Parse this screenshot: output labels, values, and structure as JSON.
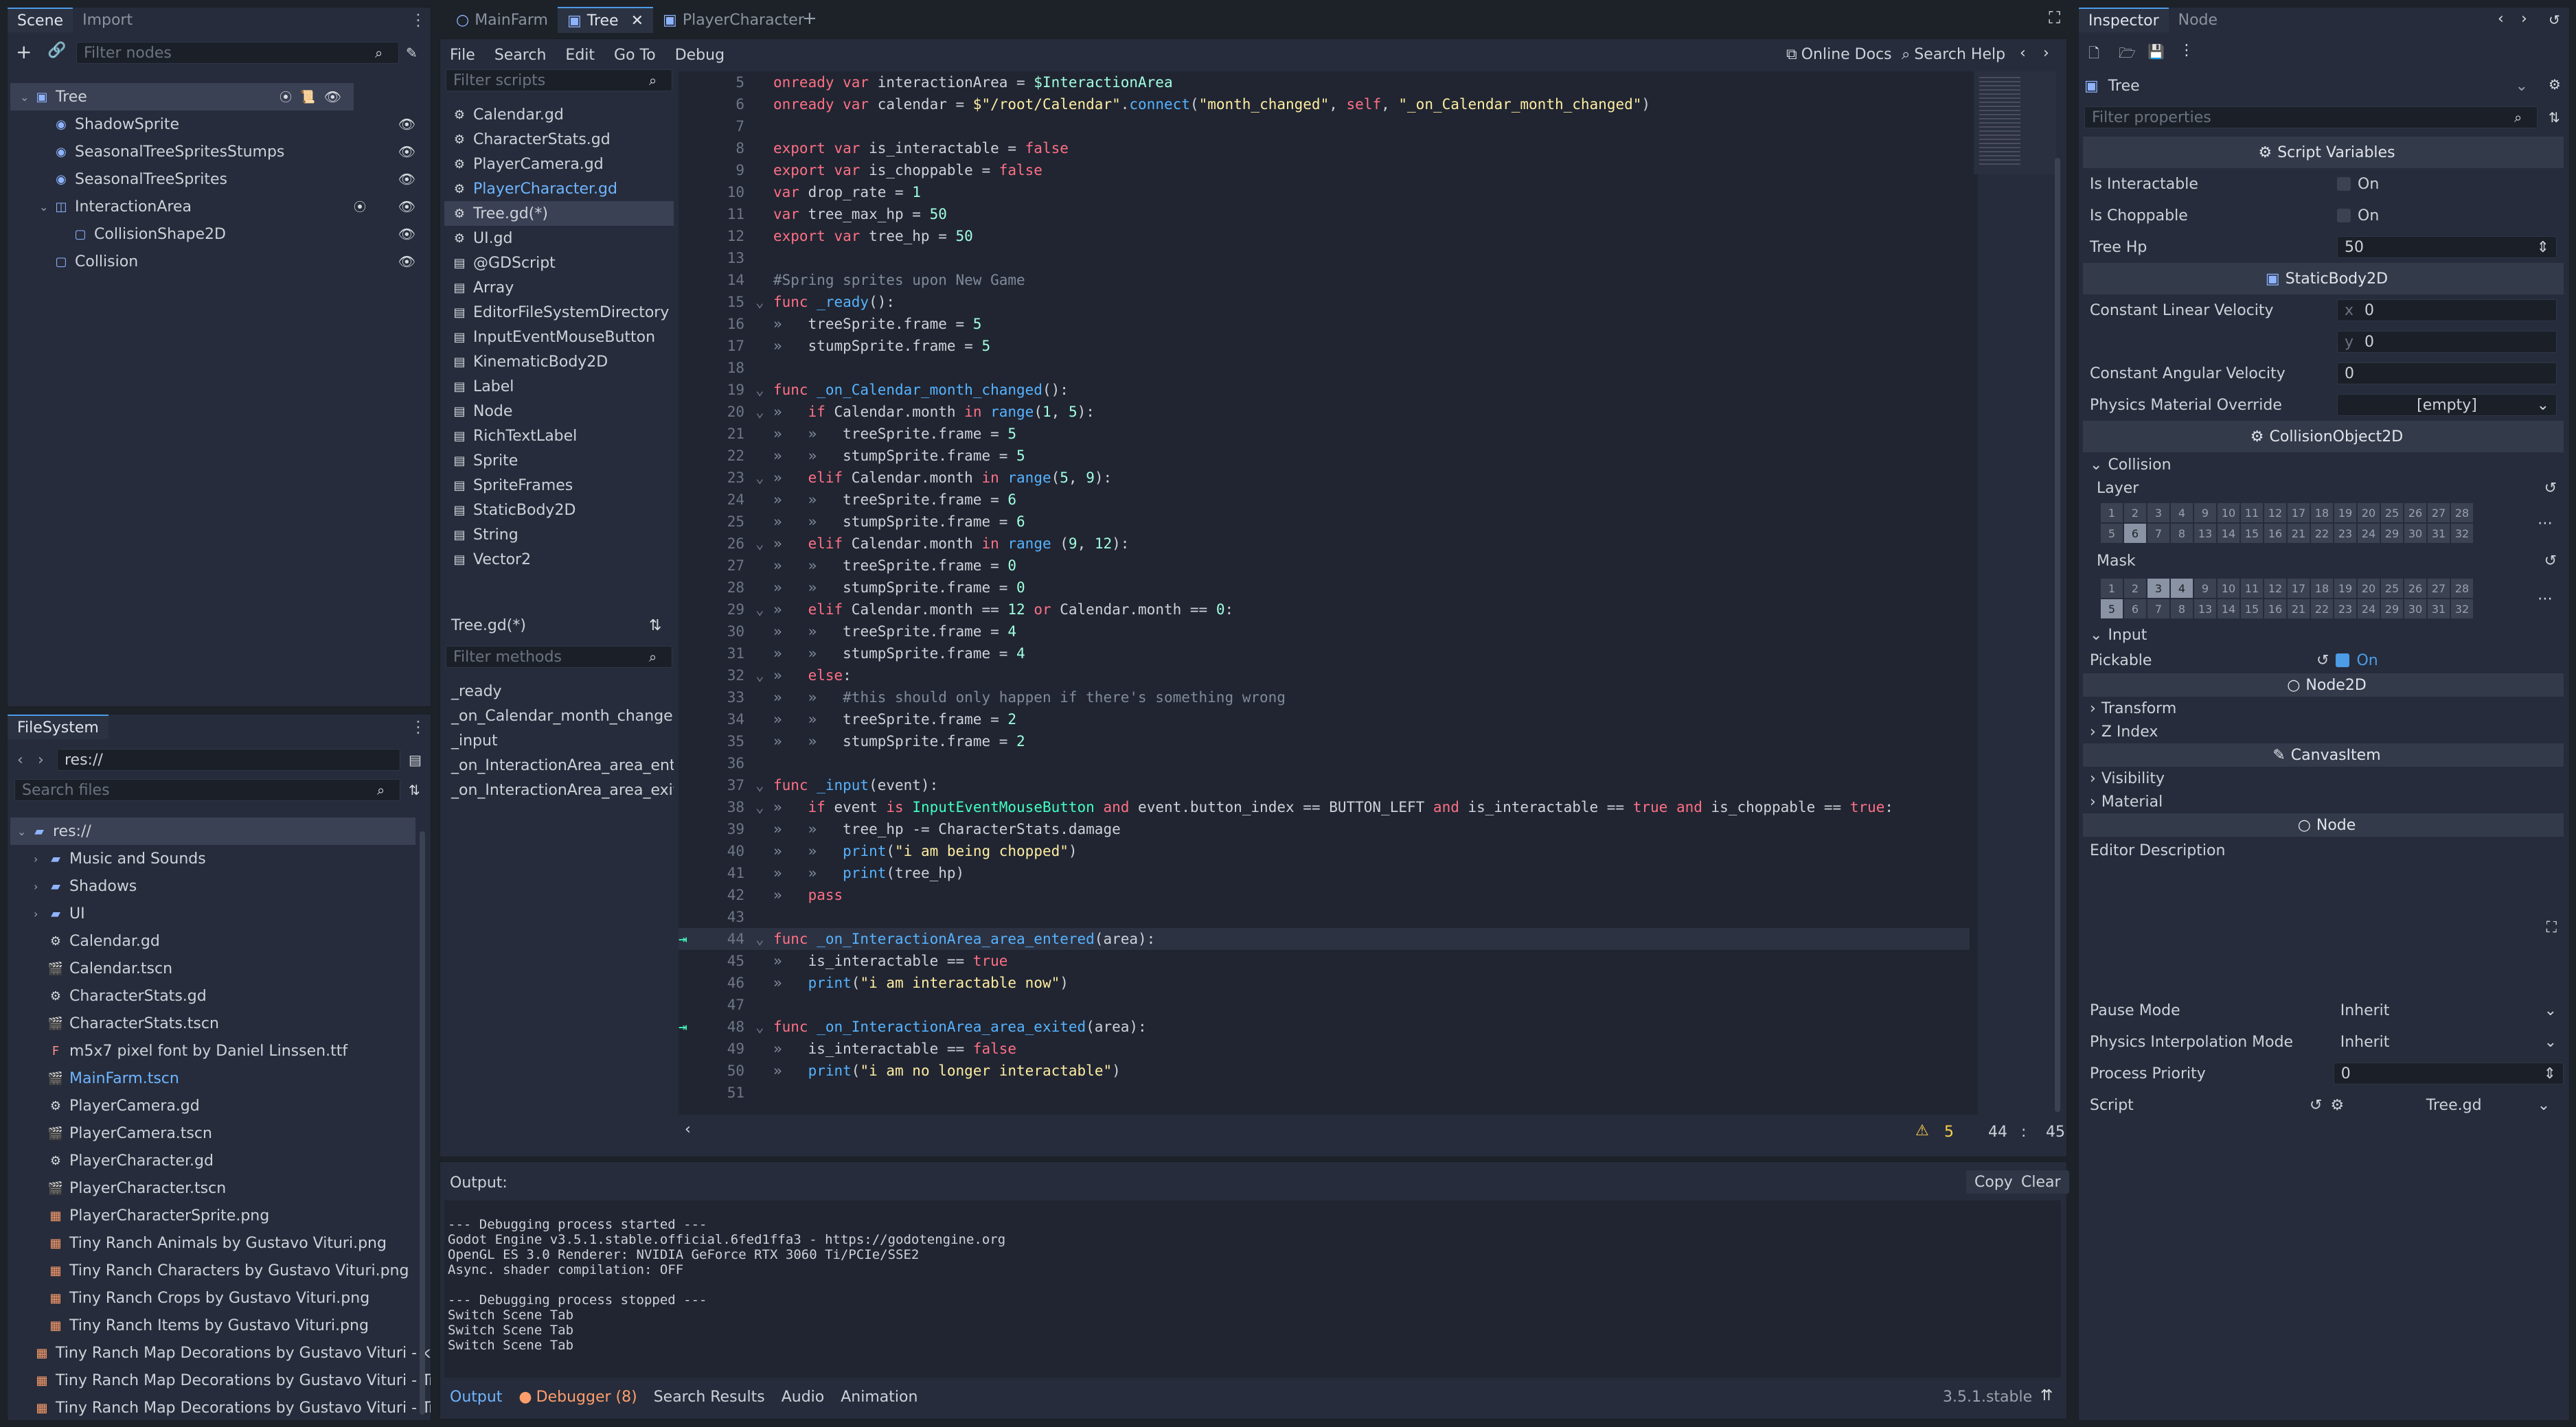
{
  "scene_dock": {
    "tabs": [
      "Scene",
      "Import"
    ],
    "filter_placeholder": "Filter nodes",
    "nodes": [
      {
        "label": "Tree",
        "depth": 0,
        "selected": true,
        "icon": "static-body-icon"
      },
      {
        "label": "ShadowSprite",
        "depth": 1,
        "icon": "sprite-icon"
      },
      {
        "label": "SeasonalTreeSpritesStumps",
        "depth": 1,
        "icon": "sprite-icon"
      },
      {
        "label": "SeasonalTreeSprites",
        "depth": 1,
        "icon": "sprite-icon"
      },
      {
        "label": "InteractionArea",
        "depth": 1,
        "icon": "area-icon"
      },
      {
        "label": "CollisionShape2D",
        "depth": 2,
        "icon": "collision-shape-icon"
      },
      {
        "label": "Collision",
        "depth": 1,
        "icon": "collision-shape-icon"
      }
    ]
  },
  "fs_dock": {
    "tab": "FileSystem",
    "path": "res://",
    "filter_placeholder": "Search files",
    "items": [
      {
        "label": "res://",
        "depth": 0,
        "type": "folder",
        "selected": true
      },
      {
        "label": "Music and Sounds",
        "depth": 1,
        "type": "folder"
      },
      {
        "label": "Shadows",
        "depth": 1,
        "type": "folder"
      },
      {
        "label": "UI",
        "depth": 1,
        "type": "folder"
      },
      {
        "label": "Calendar.gd",
        "depth": 1,
        "type": "script"
      },
      {
        "label": "Calendar.tscn",
        "depth": 1,
        "type": "scene"
      },
      {
        "label": "CharacterStats.gd",
        "depth": 1,
        "type": "script"
      },
      {
        "label": "CharacterStats.tscn",
        "depth": 1,
        "type": "scene"
      },
      {
        "label": "m5x7 pixel font by Daniel Linssen.ttf",
        "depth": 1,
        "type": "font"
      },
      {
        "label": "MainFarm.tscn",
        "depth": 1,
        "type": "scene",
        "highlight": true
      },
      {
        "label": "PlayerCamera.gd",
        "depth": 1,
        "type": "script"
      },
      {
        "label": "PlayerCamera.tscn",
        "depth": 1,
        "type": "scene"
      },
      {
        "label": "PlayerCharacter.gd",
        "depth": 1,
        "type": "script"
      },
      {
        "label": "PlayerCharacter.tscn",
        "depth": 1,
        "type": "scene"
      },
      {
        "label": "PlayerCharacterSprite.png",
        "depth": 1,
        "type": "image"
      },
      {
        "label": "Tiny Ranch Animals by Gustavo Vituri.png",
        "depth": 1,
        "type": "image"
      },
      {
        "label": "Tiny Ranch Characters by Gustavo Vituri.png",
        "depth": 1,
        "type": "image"
      },
      {
        "label": "Tiny Ranch Crops by Gustavo Vituri.png",
        "depth": 1,
        "type": "image"
      },
      {
        "label": "Tiny Ranch Items by Gustavo Vituri.png",
        "depth": 1,
        "type": "image"
      },
      {
        "label": "Tiny Ranch Map Decorations by Gustavo Vituri - kop",
        "depth": 1,
        "type": "image"
      },
      {
        "label": "Tiny Ranch Map Decorations by Gustavo Vituri - Tre",
        "depth": 1,
        "type": "image"
      },
      {
        "label": "Tiny Ranch Map Decorations by Gustavo Vituri - Tre",
        "depth": 1,
        "type": "image"
      }
    ]
  },
  "editor": {
    "tabs": [
      {
        "label": "MainFarm"
      },
      {
        "label": "Tree",
        "active": true
      },
      {
        "label": "PlayerCharacter"
      }
    ],
    "menu": [
      "File",
      "Search",
      "Edit",
      "Go To",
      "Debug"
    ],
    "online_docs": "Online Docs",
    "search_help": "Search Help",
    "scripts_filter": "Filter scripts",
    "scripts": [
      {
        "label": "Calendar.gd",
        "icon": "gear"
      },
      {
        "label": "CharacterStats.gd",
        "icon": "gear"
      },
      {
        "label": "PlayerCamera.gd",
        "icon": "gear"
      },
      {
        "label": "PlayerCharacter.gd",
        "icon": "gear",
        "highlight": true
      },
      {
        "label": "Tree.gd(*)",
        "icon": "gear",
        "selected": true
      },
      {
        "label": "UI.gd",
        "icon": "gear"
      },
      {
        "label": "@GDScript",
        "icon": "doc"
      },
      {
        "label": "Array",
        "icon": "doc"
      },
      {
        "label": "EditorFileSystemDirectory",
        "icon": "doc"
      },
      {
        "label": "InputEventMouseButton",
        "icon": "doc"
      },
      {
        "label": "KinematicBody2D",
        "icon": "doc"
      },
      {
        "label": "Label",
        "icon": "doc"
      },
      {
        "label": "Node",
        "icon": "doc"
      },
      {
        "label": "RichTextLabel",
        "icon": "doc"
      },
      {
        "label": "Sprite",
        "icon": "doc"
      },
      {
        "label": "SpriteFrames",
        "icon": "doc"
      },
      {
        "label": "StaticBody2D",
        "icon": "doc"
      },
      {
        "label": "String",
        "icon": "doc"
      },
      {
        "label": "Vector2",
        "icon": "doc"
      }
    ],
    "current_script": "Tree.gd(*)",
    "methods_filter": "Filter methods",
    "methods": [
      "_ready",
      "_on_Calendar_month_changed",
      "_input",
      "_on_InteractionArea_area_entere",
      "_on_InteractionArea_area_exited"
    ],
    "status": {
      "warnings": "5",
      "line": "44",
      "sep": ":",
      "col": "45"
    }
  },
  "code_lines": [
    {
      "n": "5",
      "t": [
        [
          "kw",
          "onready var "
        ],
        [
          "pl",
          "interactionArea = "
        ],
        [
          "nm",
          "$InteractionArea"
        ]
      ]
    },
    {
      "n": "6",
      "t": [
        [
          "kw",
          "onready var "
        ],
        [
          "pl",
          "calendar = "
        ],
        [
          "st",
          "$\"/root/Calendar\""
        ],
        [
          "pl",
          "."
        ],
        [
          "fn",
          "connect"
        ],
        [
          "pl",
          "("
        ],
        [
          "st",
          "\"month_changed\""
        ],
        [
          "pl",
          ", "
        ],
        [
          "kw",
          "self"
        ],
        [
          "pl",
          ", "
        ],
        [
          "st",
          "\"_on_Calendar_month_changed\""
        ],
        [
          "pl",
          ")"
        ]
      ]
    },
    {
      "n": "7",
      "t": []
    },
    {
      "n": "8",
      "t": [
        [
          "kw",
          "export var "
        ],
        [
          "pl",
          "is_interactable = "
        ],
        [
          "kw",
          "false"
        ]
      ]
    },
    {
      "n": "9",
      "t": [
        [
          "kw",
          "export var "
        ],
        [
          "pl",
          "is_choppable = "
        ],
        [
          "kw",
          "false"
        ]
      ]
    },
    {
      "n": "10",
      "t": [
        [
          "kw",
          "var "
        ],
        [
          "pl",
          "drop_rate = "
        ],
        [
          "nm",
          "1"
        ]
      ]
    },
    {
      "n": "11",
      "t": [
        [
          "kw",
          "var "
        ],
        [
          "pl",
          "tree_max_hp = "
        ],
        [
          "nm",
          "50"
        ]
      ]
    },
    {
      "n": "12",
      "t": [
        [
          "kw",
          "export var "
        ],
        [
          "pl",
          "tree_hp = "
        ],
        [
          "nm",
          "50"
        ]
      ]
    },
    {
      "n": "13",
      "t": []
    },
    {
      "n": "14",
      "t": [
        [
          "cm",
          "#Spring sprites upon New Game"
        ]
      ]
    },
    {
      "n": "15",
      "f": true,
      "t": [
        [
          "kw",
          "func "
        ],
        [
          "fn",
          "_ready"
        ],
        [
          "pl",
          "():"
        ]
      ]
    },
    {
      "n": "16",
      "i": 1,
      "t": [
        [
          "pl",
          "treeSprite.frame = "
        ],
        [
          "nm",
          "5"
        ]
      ]
    },
    {
      "n": "17",
      "i": 1,
      "t": [
        [
          "pl",
          "stumpSprite.frame = "
        ],
        [
          "nm",
          "5"
        ]
      ]
    },
    {
      "n": "18",
      "t": []
    },
    {
      "n": "19",
      "f": true,
      "t": [
        [
          "kw",
          "func "
        ],
        [
          "fn",
          "_on_Calendar_month_changed"
        ],
        [
          "pl",
          "():"
        ]
      ]
    },
    {
      "n": "20",
      "f": true,
      "i": 1,
      "t": [
        [
          "kw",
          "if "
        ],
        [
          "pl",
          "Calendar.month "
        ],
        [
          "kw",
          "in "
        ],
        [
          "fn",
          "range"
        ],
        [
          "pl",
          "("
        ],
        [
          "nm",
          "1"
        ],
        [
          "pl",
          ", "
        ],
        [
          "nm",
          "5"
        ],
        [
          "pl",
          "):"
        ]
      ]
    },
    {
      "n": "21",
      "i": 2,
      "t": [
        [
          "pl",
          "treeSprite.frame = "
        ],
        [
          "nm",
          "5"
        ]
      ]
    },
    {
      "n": "22",
      "i": 2,
      "t": [
        [
          "pl",
          "stumpSprite.frame = "
        ],
        [
          "nm",
          "5"
        ]
      ]
    },
    {
      "n": "23",
      "f": true,
      "i": 1,
      "t": [
        [
          "kw",
          "elif "
        ],
        [
          "pl",
          "Calendar.month "
        ],
        [
          "kw",
          "in "
        ],
        [
          "fn",
          "range"
        ],
        [
          "pl",
          "("
        ],
        [
          "nm",
          "5"
        ],
        [
          "pl",
          ", "
        ],
        [
          "nm",
          "9"
        ],
        [
          "pl",
          "):"
        ]
      ]
    },
    {
      "n": "24",
      "i": 2,
      "t": [
        [
          "pl",
          "treeSprite.frame = "
        ],
        [
          "nm",
          "6"
        ]
      ]
    },
    {
      "n": "25",
      "i": 2,
      "t": [
        [
          "pl",
          "stumpSprite.frame = "
        ],
        [
          "nm",
          "6"
        ]
      ]
    },
    {
      "n": "26",
      "f": true,
      "i": 1,
      "t": [
        [
          "kw",
          "elif "
        ],
        [
          "pl",
          "Calendar.month "
        ],
        [
          "kw",
          "in "
        ],
        [
          "fn",
          "range "
        ],
        [
          "pl",
          "("
        ],
        [
          "nm",
          "9"
        ],
        [
          "pl",
          ", "
        ],
        [
          "nm",
          "12"
        ],
        [
          "pl",
          "):"
        ]
      ]
    },
    {
      "n": "27",
      "i": 2,
      "t": [
        [
          "pl",
          "treeSprite.frame = "
        ],
        [
          "nm",
          "0"
        ]
      ]
    },
    {
      "n": "28",
      "i": 2,
      "t": [
        [
          "pl",
          "stumpSprite.frame = "
        ],
        [
          "nm",
          "0"
        ]
      ]
    },
    {
      "n": "29",
      "f": true,
      "i": 1,
      "t": [
        [
          "kw",
          "elif "
        ],
        [
          "pl",
          "Calendar.month == "
        ],
        [
          "nm",
          "12"
        ],
        [
          "kw",
          " or "
        ],
        [
          "pl",
          "Calendar.month == "
        ],
        [
          "nm",
          "0"
        ],
        [
          "pl",
          ":"
        ]
      ]
    },
    {
      "n": "30",
      "i": 2,
      "t": [
        [
          "pl",
          "treeSprite.frame = "
        ],
        [
          "nm",
          "4"
        ]
      ]
    },
    {
      "n": "31",
      "i": 2,
      "t": [
        [
          "pl",
          "stumpSprite.frame = "
        ],
        [
          "nm",
          "4"
        ]
      ]
    },
    {
      "n": "32",
      "f": true,
      "i": 1,
      "t": [
        [
          "kw",
          "else"
        ],
        [
          "pl",
          ":"
        ]
      ]
    },
    {
      "n": "33",
      "i": 2,
      "t": [
        [
          "cm",
          "#this should only happen if there's something wrong"
        ]
      ]
    },
    {
      "n": "34",
      "i": 2,
      "t": [
        [
          "pl",
          "treeSprite.frame = "
        ],
        [
          "nm",
          "2"
        ]
      ]
    },
    {
      "n": "35",
      "i": 2,
      "t": [
        [
          "pl",
          "stumpSprite.frame = "
        ],
        [
          "nm",
          "2"
        ]
      ]
    },
    {
      "n": "36",
      "t": []
    },
    {
      "n": "37",
      "f": true,
      "t": [
        [
          "kw",
          "func "
        ],
        [
          "fn",
          "_input"
        ],
        [
          "pl",
          "(event):"
        ]
      ]
    },
    {
      "n": "38",
      "f": true,
      "i": 1,
      "t": [
        [
          "kw",
          "if "
        ],
        [
          "pl",
          "event "
        ],
        [
          "kw",
          "is "
        ],
        [
          "cls",
          "InputEventMouseButton"
        ],
        [
          "kw",
          " and "
        ],
        [
          "pl",
          "event.button_index == BUTTON_LEFT "
        ],
        [
          "kw",
          "and "
        ],
        [
          "pl",
          "is_interactable == "
        ],
        [
          "kw",
          "true"
        ],
        [
          "kw",
          " and "
        ],
        [
          "pl",
          "is_choppable == "
        ],
        [
          "kw",
          "true"
        ],
        [
          "pl",
          ":"
        ]
      ]
    },
    {
      "n": "39",
      "i": 2,
      "t": [
        [
          "pl",
          "tree_hp -= CharacterStats.damage"
        ]
      ]
    },
    {
      "n": "40",
      "i": 2,
      "t": [
        [
          "fn",
          "print"
        ],
        [
          "pl",
          "("
        ],
        [
          "st",
          "\"i am being chopped\""
        ],
        [
          "pl",
          ")"
        ]
      ]
    },
    {
      "n": "41",
      "i": 2,
      "t": [
        [
          "fn",
          "print"
        ],
        [
          "pl",
          "(tree_hp)"
        ]
      ]
    },
    {
      "n": "42",
      "i": 1,
      "t": [
        [
          "kw",
          "pass"
        ]
      ]
    },
    {
      "n": "43",
      "t": []
    },
    {
      "n": "44",
      "f": true,
      "sig": true,
      "cur": true,
      "t": [
        [
          "kw",
          "func "
        ],
        [
          "fn",
          "_on_InteractionArea_area_entered"
        ],
        [
          "pl",
          "(area):"
        ]
      ]
    },
    {
      "n": "45",
      "i": 1,
      "t": [
        [
          "pl",
          "is_interactable == "
        ],
        [
          "kw",
          "true"
        ]
      ]
    },
    {
      "n": "46",
      "i": 1,
      "t": [
        [
          "fn",
          "print"
        ],
        [
          "pl",
          "("
        ],
        [
          "st",
          "\"i am interactable now\""
        ],
        [
          "pl",
          ")"
        ]
      ]
    },
    {
      "n": "47",
      "t": []
    },
    {
      "n": "48",
      "f": true,
      "sig": true,
      "t": [
        [
          "kw",
          "func "
        ],
        [
          "fn",
          "_on_InteractionArea_area_exited"
        ],
        [
          "pl",
          "(area):"
        ]
      ]
    },
    {
      "n": "49",
      "i": 1,
      "t": [
        [
          "pl",
          "is_interactable == "
        ],
        [
          "kw",
          "false"
        ]
      ]
    },
    {
      "n": "50",
      "i": 1,
      "t": [
        [
          "fn",
          "print"
        ],
        [
          "pl",
          "("
        ],
        [
          "st",
          "\"i am no longer interactable\""
        ],
        [
          "pl",
          ")"
        ]
      ]
    },
    {
      "n": "51",
      "t": []
    }
  ],
  "output": {
    "title": "Output:",
    "copy": "Copy",
    "clear": "Clear",
    "lines": [
      "--- Debugging process started ---",
      "Godot Engine v3.5.1.stable.official.6fed1ffa3 - https://godotengine.org",
      "OpenGL ES 3.0 Renderer: NVIDIA GeForce RTX 3060 Ti/PCIe/SSE2",
      "Async. shader compilation: OFF",
      "",
      "--- Debugging process stopped ---",
      "Switch Scene Tab",
      "Switch Scene Tab",
      "Switch Scene Tab"
    ]
  },
  "bottom": {
    "tabs": [
      "Output",
      "Debugger (8)",
      "Search Results",
      "Audio",
      "Animation"
    ],
    "version": "3.5.1.stable"
  },
  "inspector": {
    "tabs": [
      "Inspector",
      "Node"
    ],
    "object": "Tree",
    "filter_placeholder": "Filter properties",
    "sec_script": "Script Variables",
    "is_interactable": "Is Interactable",
    "is_choppable": "Is Choppable",
    "on": "On",
    "tree_hp": "Tree Hp",
    "tree_hp_val": "50",
    "sec_static": "StaticBody2D",
    "const_lin": "Constant Linear Velocity",
    "x": "x",
    "y": "y",
    "zero": "0",
    "const_ang": "Constant Angular Velocity",
    "phys_mat": "Physics Material Override",
    "empty": "[empty]",
    "sec_colobj": "CollisionObject2D",
    "collision": "Collision",
    "layer": "Layer",
    "mask": "Mask",
    "layer_on": [
      6
    ],
    "mask_on": [
      3,
      4,
      5
    ],
    "input": "Input",
    "pickable": "Pickable",
    "sec_node2d": "Node2D",
    "transform": "Transform",
    "zindex": "Z Index",
    "sec_canvas": "CanvasItem",
    "visibility": "Visibility",
    "material": "Material",
    "sec_node": "Node",
    "editor_desc": "Editor Description",
    "pause": "Pause Mode",
    "pause_val": "Inherit",
    "phys_interp": "Physics Interpolation Mode",
    "phys_interp_val": "Inherit",
    "proc_prio": "Process Priority",
    "proc_prio_val": "0",
    "script": "Script",
    "script_val": "Tree.gd"
  }
}
